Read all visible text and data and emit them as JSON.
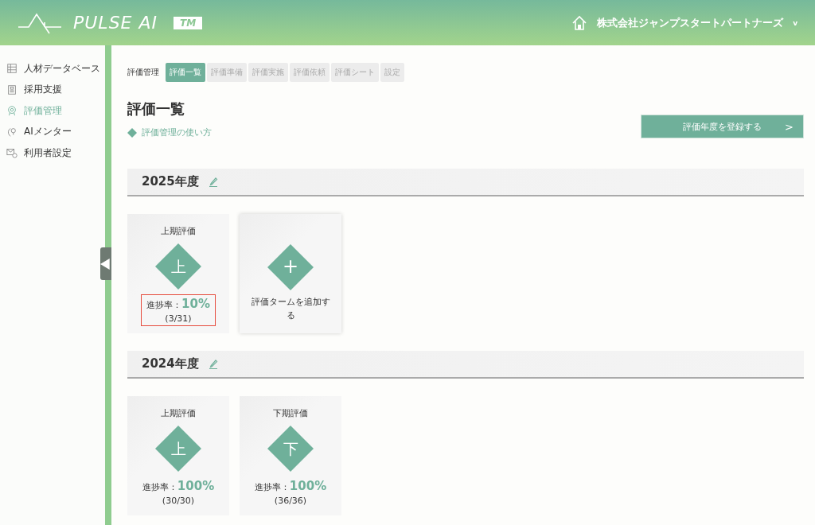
{
  "header": {
    "logo": "PULSE AI",
    "trademark": "TM",
    "company": "株式会社ジャンプスタートパートナーズ",
    "dropdown": "v"
  },
  "sidebar": {
    "items": [
      {
        "label": "人材データベース",
        "kind": "database",
        "selected": false
      },
      {
        "label": "採用支援",
        "kind": "document",
        "selected": false
      },
      {
        "label": "評価管理",
        "kind": "badge",
        "selected": true
      },
      {
        "label": "AIメンター",
        "kind": "mentor",
        "selected": false
      },
      {
        "label": "利用者設定",
        "kind": "settings",
        "selected": false
      }
    ]
  },
  "breadcrumb": "評価管理",
  "tabs": [
    {
      "label": "評価一覧",
      "selected": true
    },
    {
      "label": "評価準備",
      "selected": false
    },
    {
      "label": "評価実施",
      "selected": false
    },
    {
      "label": "評価依頼",
      "selected": false
    },
    {
      "label": "評価シート",
      "selected": false
    },
    {
      "label": "設定",
      "selected": false
    }
  ],
  "page_title": "評価一覧",
  "help_link": "評価管理の使い方",
  "register_button": {
    "label": "評価年度を登録する",
    "arrow": ">"
  },
  "years": [
    {
      "title": "2025年度",
      "cards": [
        {
          "kind": "term",
          "title": "上期評価",
          "symbol": "上",
          "progress_label": "進捗率：",
          "percent": "10%",
          "count": "(3/31)",
          "highlighted": true
        },
        {
          "kind": "add",
          "symbol": "+",
          "label": "評価タームを追加する"
        }
      ]
    },
    {
      "title": "2024年度",
      "cards": [
        {
          "kind": "term",
          "title": "上期評価",
          "symbol": "上",
          "progress_label": "進捗率：",
          "percent": "100%",
          "count": "(30/30)",
          "highlighted": false
        },
        {
          "kind": "term",
          "title": "下期評価",
          "symbol": "下",
          "progress_label": "進捗率：",
          "percent": "100%",
          "count": "(36/36)",
          "highlighted": false
        }
      ]
    }
  ]
}
